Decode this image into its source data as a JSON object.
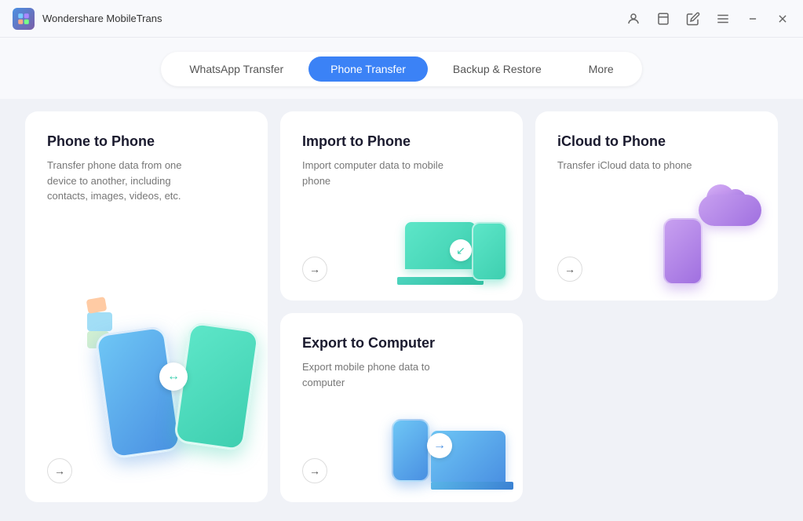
{
  "app": {
    "name": "Wondershare MobileTrans",
    "logo_alt": "MobileTrans Logo"
  },
  "titlebar": {
    "controls": {
      "account": "👤",
      "bookmark": "🔖",
      "edit": "✏️",
      "menu": "☰",
      "minimize": "−",
      "close": "✕"
    }
  },
  "nav": {
    "tabs": [
      {
        "id": "whatsapp",
        "label": "WhatsApp Transfer",
        "active": false
      },
      {
        "id": "phone",
        "label": "Phone Transfer",
        "active": true
      },
      {
        "id": "backup",
        "label": "Backup & Restore",
        "active": false
      },
      {
        "id": "more",
        "label": "More",
        "active": false
      }
    ]
  },
  "cards": {
    "phone_to_phone": {
      "title": "Phone to Phone",
      "description": "Transfer phone data from one device to another, including contacts, images, videos, etc.",
      "arrow": "→"
    },
    "import_to_phone": {
      "title": "Import to Phone",
      "description": "Import computer data to mobile phone",
      "arrow": "→"
    },
    "icloud_to_phone": {
      "title": "iCloud to Phone",
      "description": "Transfer iCloud data to phone",
      "arrow": "→"
    },
    "export_to_computer": {
      "title": "Export to Computer",
      "description": "Export mobile phone data to computer",
      "arrow": "→"
    }
  }
}
